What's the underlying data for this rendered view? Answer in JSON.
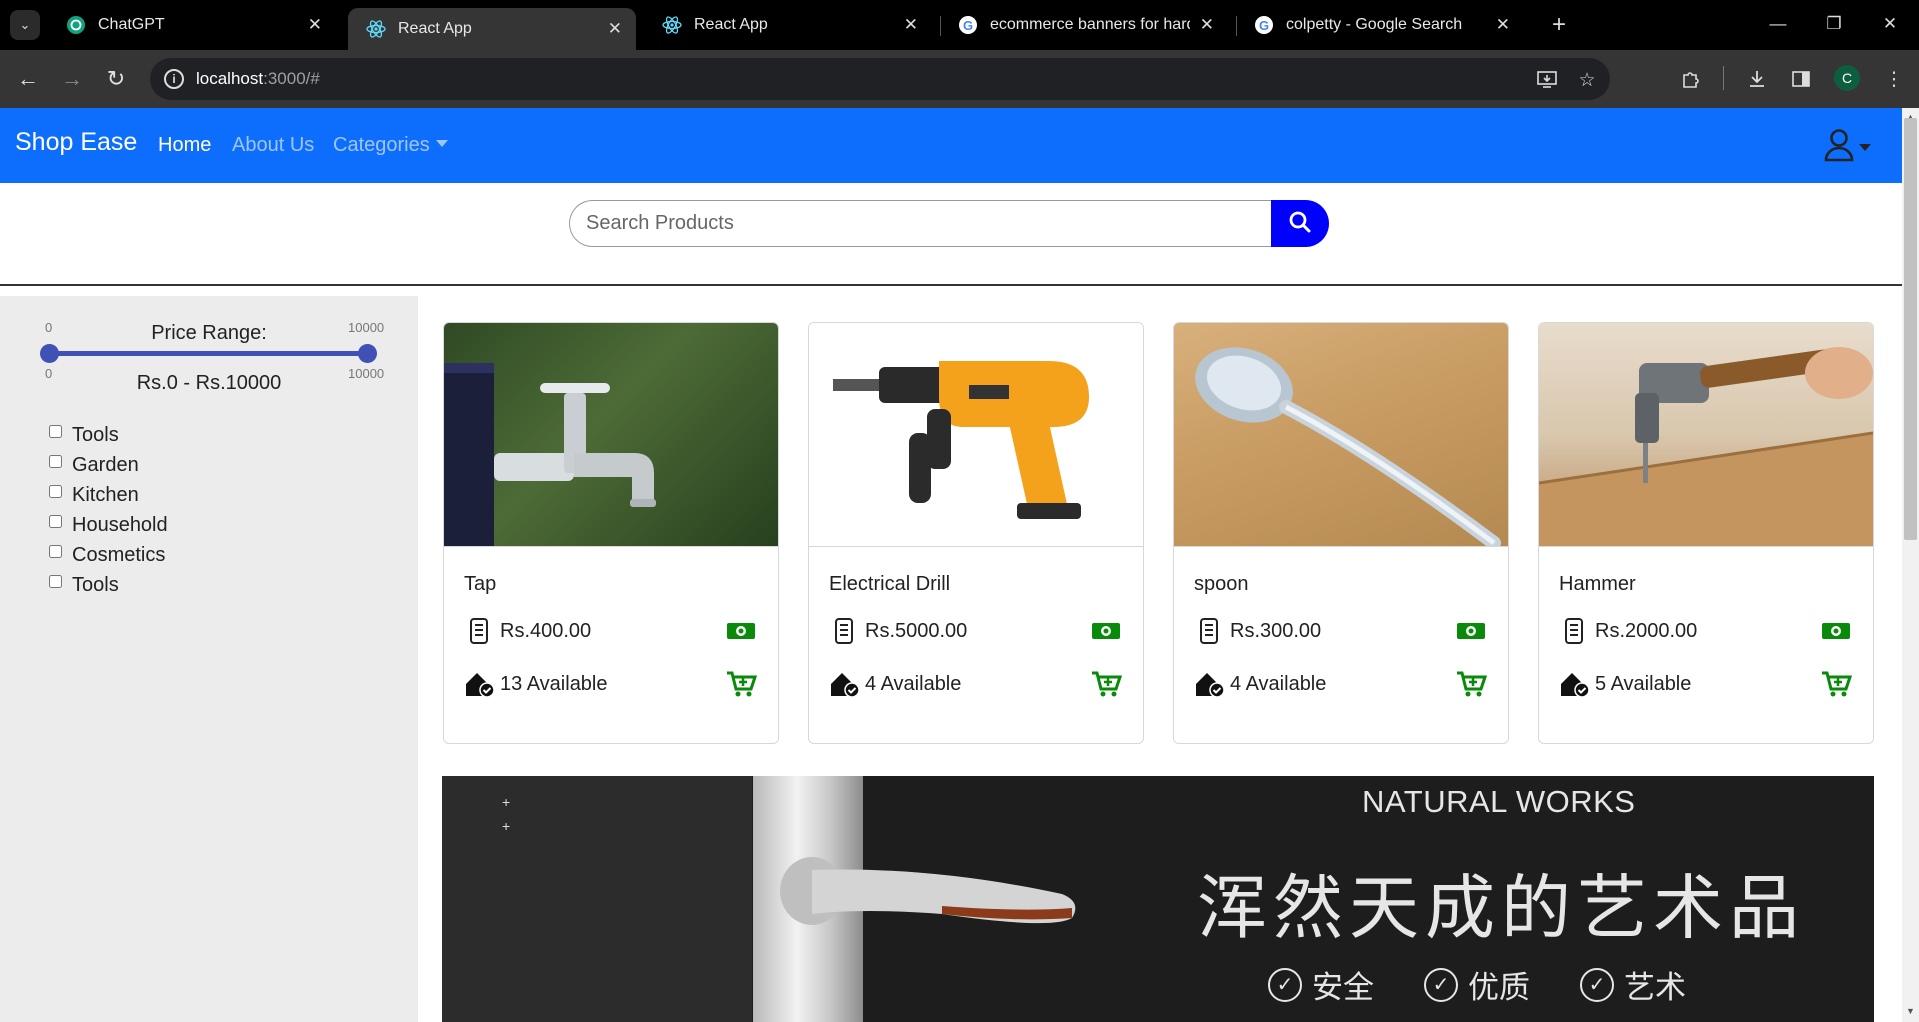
{
  "browser": {
    "tabs": [
      {
        "title": "ChatGPT",
        "icon": "chatgpt-icon",
        "active": false
      },
      {
        "title": "React App",
        "icon": "react-icon",
        "active": true
      },
      {
        "title": "React App",
        "icon": "react-icon",
        "active": false
      },
      {
        "title": "ecommerce banners for hardwa",
        "icon": "google-icon",
        "active": false
      },
      {
        "title": "colpetty - Google Search",
        "icon": "google-icon",
        "active": false
      }
    ],
    "url_host": "localhost",
    "url_rest": ":3000/#",
    "profile_initial": "C"
  },
  "navbar": {
    "brand": "Shop Ease",
    "links": [
      "Home",
      "About Us",
      "Categories"
    ],
    "bg_color": "#0d6efd"
  },
  "search": {
    "placeholder": "Search Products",
    "button_color": "#0000ff"
  },
  "sidebar": {
    "range_title": "Price Range:",
    "min_label": "0",
    "max_label": "10000",
    "range_value": "Rs.0 - Rs.10000",
    "slider_min": 0,
    "slider_max": 10000,
    "categories": [
      "Tools",
      "Garden",
      "Kitchen",
      "Household",
      "Cosmetics",
      "Tools"
    ]
  },
  "products": [
    {
      "name": "Tap",
      "price": "Rs.400.00",
      "stock": "13 Available"
    },
    {
      "name": "Electrical Drill",
      "price": "Rs.5000.00",
      "stock": "4 Available"
    },
    {
      "name": "spoon",
      "price": "Rs.300.00",
      "stock": "4 Available"
    },
    {
      "name": "Hammer",
      "price": "Rs.2000.00",
      "stock": "5 Available"
    }
  ],
  "banner": {
    "bullets": [
      "+",
      "+"
    ],
    "title_en": "NATURAL WORKS",
    "title_cn": "浑然天成的艺术品",
    "features": [
      "安全",
      "优质",
      "艺术"
    ]
  }
}
